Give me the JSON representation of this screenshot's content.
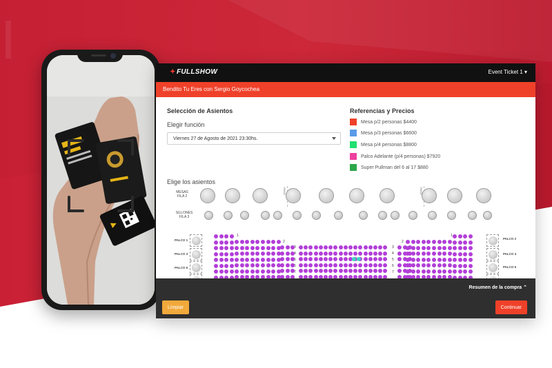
{
  "colors": {
    "brand": "#ef4129",
    "topbar": "#111111",
    "seat_available": "#b23fd8",
    "seat_selected": "#3fd8c0"
  },
  "app": {
    "logo": "FULLSHOW",
    "account_menu": "Event Ticket 1 ▾"
  },
  "event": {
    "title": "Bendito Tu Eres con Sergio Goycochea"
  },
  "seleccion": {
    "heading": "Selección de Asientos",
    "funcion_label": "Elegir función",
    "funcion_value": "Viernes 27 de Agosto de 2021 23:30hs."
  },
  "referencias": {
    "heading": "Referencias y Precios",
    "items": [
      {
        "label": "Mesa p/2 personas $4400",
        "color": "#ef4129"
      },
      {
        "label": "Mesa p/3 personas $6600",
        "color": "#5a9be8"
      },
      {
        "label": "Mesa p/4 personas $8800",
        "color": "#20e070"
      },
      {
        "label": "Palco Adelante (p/4 personas) $7920",
        "color": "#ee3f9e"
      },
      {
        "label": "Super Pullman del 6 al 17 $880",
        "color": "#2ba84a"
      }
    ]
  },
  "map": {
    "heading": "Elige los asientos",
    "mesas_label_1": "MESAS",
    "mesas_label_2": "FILA 2",
    "sillones_label_1": "SILLONES",
    "sillones_label_2": "FILA 3",
    "pasillo": "PASO",
    "palcos_left": [
      "PALCO 1",
      "PALCO 3",
      "PALCO 5"
    ],
    "palcos_right": [
      "PALCO 2",
      "PALCO 4",
      "PALCO 6"
    ],
    "row_numbers": [
      "1",
      "2",
      "3",
      "4",
      "5",
      "6",
      "7"
    ]
  },
  "footer": {
    "summary": "Resumen de la compra ⌃",
    "clear": "Limpiar",
    "continue": "Continuar"
  }
}
